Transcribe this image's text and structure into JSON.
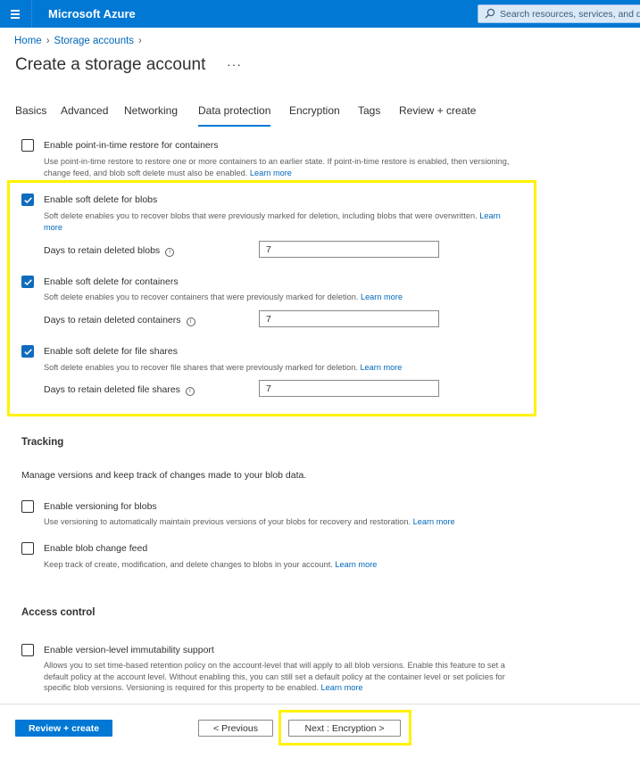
{
  "app": {
    "brand": "Microsoft Azure",
    "search_placeholder": "Search resources, services, and docs (G+/)"
  },
  "breadcrumb": [
    {
      "label": "Home"
    },
    {
      "label": "Storage accounts"
    }
  ],
  "page": {
    "title": "Create a storage account",
    "more": "···"
  },
  "tabs": [
    {
      "label": "Basics"
    },
    {
      "label": "Advanced"
    },
    {
      "label": "Networking"
    },
    {
      "label": "Data protection",
      "active": true
    },
    {
      "label": "Encryption"
    },
    {
      "label": "Tags"
    },
    {
      "label": "Review + create"
    }
  ],
  "recovery": {
    "pitr": {
      "checked": false,
      "label": "Enable point-in-time restore for containers",
      "desc_line1": "Use point-in-time restore to restore one or more containers to an earlier state. If point-in-time restore is enabled, then versioning,",
      "desc_line2": "change feed, and blob soft delete must also be enabled.",
      "learn": "Learn more"
    },
    "soft_delete_blobs": {
      "checked": true,
      "label": "Enable soft delete for blobs",
      "desc_line1": "Soft delete enables you to recover blobs that were previously marked for deletion, including blobs that were overwritten.",
      "learn_part1": "Learn",
      "learn_part2": "more",
      "days_label": "Days to retain deleted blobs",
      "days_value": "7"
    },
    "soft_delete_containers": {
      "checked": true,
      "label": "Enable soft delete for containers",
      "desc": "Soft delete enables you to recover containers that were previously marked for deletion.",
      "learn": "Learn more",
      "days_label": "Days to retain deleted containers",
      "days_value": "7"
    },
    "soft_delete_shares": {
      "checked": true,
      "label": "Enable soft delete for file shares",
      "desc": "Soft delete enables you to recover file shares that were previously marked for deletion.",
      "learn": "Learn more",
      "days_label": "Days to retain deleted file shares",
      "days_value": "7"
    }
  },
  "tracking": {
    "title": "Tracking",
    "desc": "Manage versions and keep track of changes made to your blob data.",
    "versioning": {
      "checked": false,
      "label": "Enable versioning for blobs",
      "desc": "Use versioning to automatically maintain previous versions of your blobs for recovery and restoration.",
      "learn": "Learn more"
    },
    "change_feed": {
      "checked": false,
      "label": "Enable blob change feed",
      "desc": "Keep track of create, modification, and delete changes to blobs in your account.",
      "learn": "Learn more"
    }
  },
  "access_control": {
    "title": "Access control",
    "immutability": {
      "checked": false,
      "label": "Enable version-level immutability support",
      "desc_line1": "Allows you to set time-based retention policy on the account-level that will apply to all blob versions. Enable this feature to set a",
      "desc_line2": "default policy at the account level. Without enabling this, you can still set a default policy at the container level or set policies for",
      "desc_line3": "specific blob versions. Versioning is required for this property to be enabled.",
      "learn": "Learn more"
    }
  },
  "footer": {
    "review_create": "Review + create",
    "previous": "< Previous",
    "next": "Next : Encryption >"
  },
  "colors": {
    "accent": "#0078d4",
    "link": "#0067b8",
    "highlight": "#fff200"
  }
}
